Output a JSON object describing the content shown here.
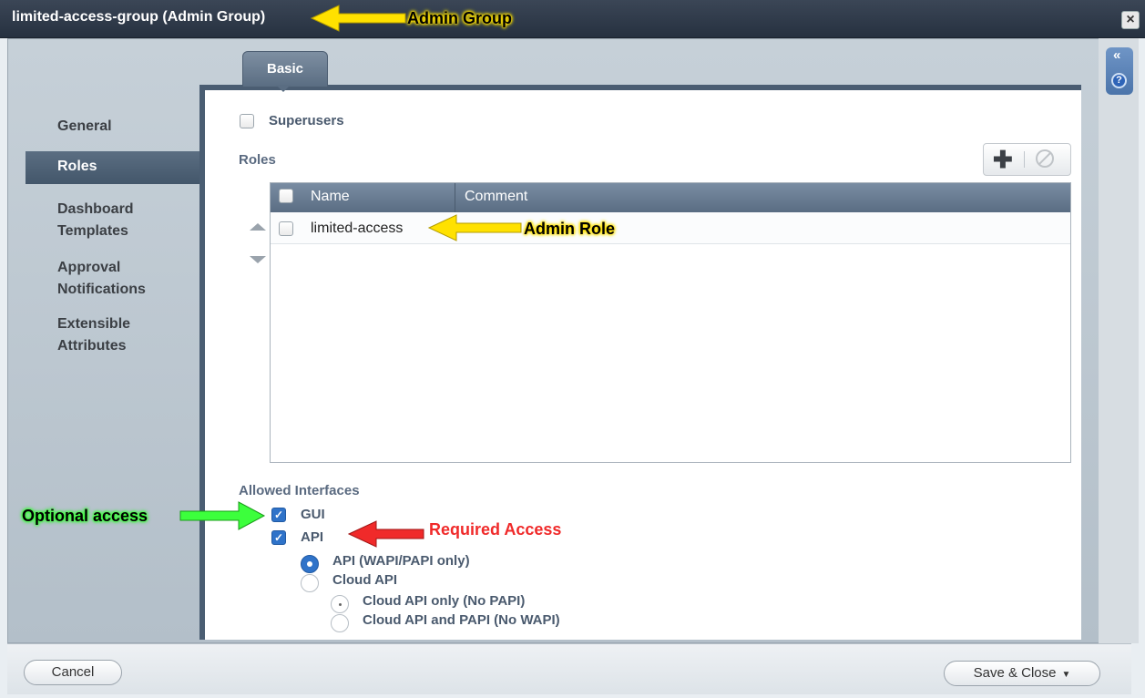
{
  "window": {
    "title": "limited-access-group (Admin Group)"
  },
  "icons": {
    "close": "×",
    "collapse": "«",
    "help": "?",
    "add": "✚",
    "check": "✓"
  },
  "sidebar": {
    "items": [
      {
        "label": "General"
      },
      {
        "label": "Roles",
        "active": true
      },
      {
        "label_line1": "Dashboard",
        "label_line2": "Templates"
      },
      {
        "label_line1": "Approval",
        "label_line2": "Notifications"
      },
      {
        "label_line1": "Extensible",
        "label_line2": "Attributes"
      }
    ]
  },
  "tabs": [
    {
      "label": "Basic"
    }
  ],
  "basic": {
    "superusers_label": "Superusers",
    "superusers_checked": false,
    "roles_label": "Roles",
    "table": {
      "columns": [
        "Name",
        "Comment"
      ],
      "rows": [
        {
          "name": "limited-access",
          "comment": ""
        }
      ]
    },
    "allowed_interfaces": {
      "label": "Allowed Interfaces",
      "gui": {
        "label": "GUI",
        "checked": true
      },
      "api": {
        "label": "API",
        "checked": true
      },
      "api_options": [
        {
          "label": "API (WAPI/PAPI only)",
          "selected": true
        },
        {
          "label": "Cloud API",
          "selected": false
        }
      ],
      "cloud_options": [
        {
          "label": "Cloud API only (No PAPI)"
        },
        {
          "label": "Cloud API and PAPI (No WAPI)"
        }
      ]
    }
  },
  "footer": {
    "cancel": "Cancel",
    "save_close": "Save & Close",
    "caret": "▼"
  },
  "annotations": {
    "admin_group": "Admin Group",
    "admin_role": "Admin Role",
    "optional_access": "Optional access",
    "required_access": "Required Access"
  },
  "colors": {
    "yellow": "#ffe100",
    "green": "#3cff3c",
    "red": "#f02a2a",
    "accent": "#2f73c9"
  }
}
